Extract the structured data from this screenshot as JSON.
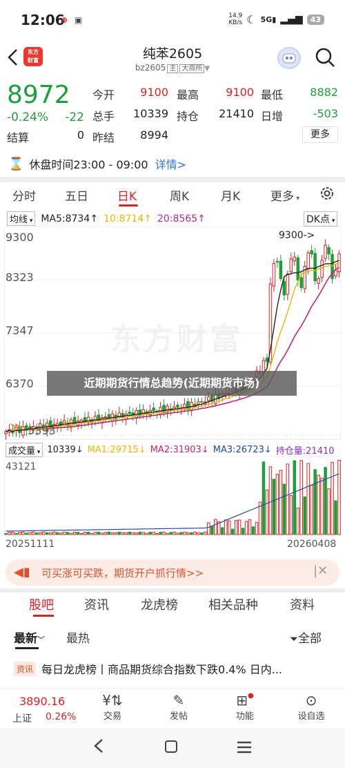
{
  "status": {
    "time": "12:06",
    "speed": "14.9\nKB/s",
    "battery": "43",
    "icons": [
      "unicom-icon",
      "moon-icon",
      "5g-icon",
      "wifi-icon",
      "signal-icon"
    ]
  },
  "header": {
    "logo": "东方\n财富",
    "title": "纯苯2605",
    "code": "bz2605",
    "tag1": "主",
    "tag2": "大商所"
  },
  "quote": {
    "price": "8972",
    "change_pct": "-0.24%",
    "change": "-22",
    "open_label": "今开",
    "open": "9100",
    "high_label": "最高",
    "high": "9100",
    "low_label": "最低",
    "low": "8882",
    "volume_label": "总手",
    "volume": "10339",
    "position_label": "持仓",
    "position": "21410",
    "daily_inc_label": "日增",
    "daily_inc": "-503",
    "settle_label": "结算",
    "settle": "0",
    "prev_settle_label": "昨结",
    "prev_settle": "8994",
    "more": "更多"
  },
  "hours": {
    "text": "休盘时间23:00 - 09:00",
    "detail": "详情>"
  },
  "tabs": [
    "分时",
    "五日",
    "日K",
    "周K",
    "月K",
    "更多"
  ],
  "active_tab": "日K",
  "chart_ind": {
    "avg": "均线",
    "ma5": "MA5:8734",
    "ma10": "10:8714",
    "ma20": "20:8565",
    "dk": "DK点"
  },
  "price_axis": [
    "9300",
    "8323",
    "7347",
    "6370",
    "5393"
  ],
  "annotation": "9300->",
  "watermark": "东方财富",
  "overlay": "近期期货行情总趋势(近期期货市场)",
  "vol_ind": {
    "label": "成交量",
    "vol": "10339",
    "ma1": "MA1:29715",
    "ma2": "MA2:31903",
    "ma3": "MA3:26723",
    "oi": "持仓量:21410"
  },
  "vol_axis_top": "43121",
  "dates": {
    "start": "20251111",
    "end": "20260408"
  },
  "ad": {
    "text": "可买涨可买跌，期货开户抓行情>>"
  },
  "bottom_tabs": [
    "股吧",
    "资讯",
    "龙虎榜",
    "相关品种",
    "资料"
  ],
  "sort": {
    "latest": "最新",
    "hot": "最热",
    "all": "全部"
  },
  "news": {
    "tag": "资讯",
    "text": "每日龙虎榜丨商品期货综合指数下跌0.4% 日内..."
  },
  "nav": {
    "index_val": "3890.16",
    "index_name": "上证",
    "index_pct": "0.26%",
    "trade": "交易",
    "post": "发帖",
    "func": "功能",
    "settings": "设自选"
  },
  "colors": {
    "red": "#e02020",
    "green": "#1e9e3a",
    "ma5": "#222222",
    "ma10": "#e6b800",
    "ma20": "#c0267a"
  }
}
